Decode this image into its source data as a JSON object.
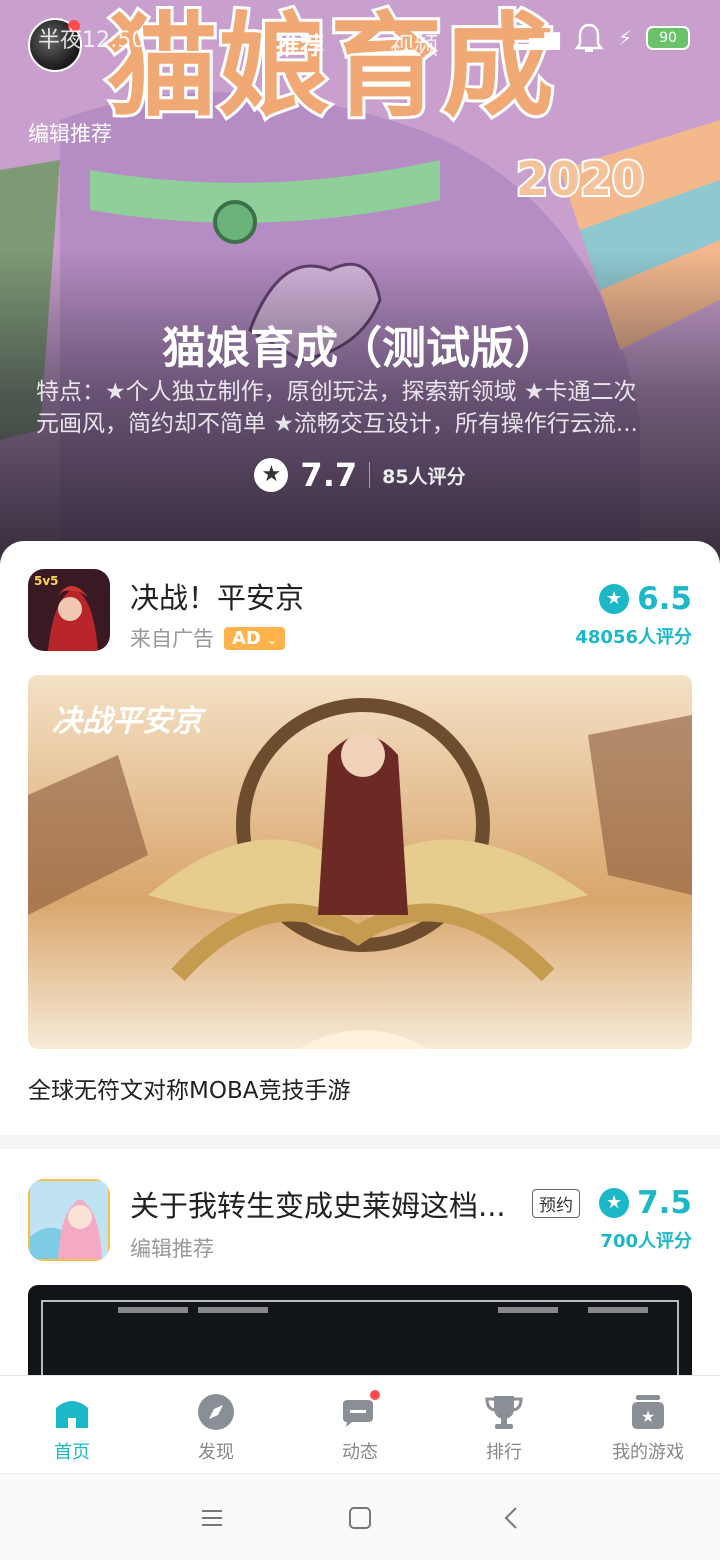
{
  "status_bar": {
    "time": "半夜12:50",
    "battery": "90"
  },
  "top_tabs": [
    {
      "label": "推荐",
      "active": true
    },
    {
      "label": "视频",
      "active": false
    }
  ],
  "hero": {
    "section_label": "编辑推荐",
    "title": "猫娘育成（测试版）",
    "desc_line1": "特点：★个人独立制作，原创玩法，探索新领域 ★卡通二次",
    "desc_line2": "元画风，简约却不简单 ★流畅交互设计，所有操作行云流...",
    "score": "7.7",
    "rating_count": "85人评分",
    "art_text": "猫娘育成",
    "art_year": "2020"
  },
  "games": [
    {
      "name": "决战！平安京",
      "source": "来自广告",
      "badge": "AD",
      "score": "6.5",
      "rating_count": "48056人评分",
      "banner_logo": "决战平安京",
      "tagline": "全球无符文对称MOBA竞技手游"
    },
    {
      "name": "关于我转生变成史莱姆这档...",
      "badge": "预约",
      "source": "编辑推荐",
      "score": "7.5",
      "rating_count": "700人评分"
    }
  ],
  "bottom_nav": [
    {
      "label": "首页",
      "icon": "home-icon",
      "active": true
    },
    {
      "label": "发现",
      "icon": "compass-icon",
      "active": false
    },
    {
      "label": "动态",
      "icon": "chat-icon",
      "active": false,
      "badge": true
    },
    {
      "label": "排行",
      "icon": "trophy-icon",
      "active": false
    },
    {
      "label": "我的游戏",
      "icon": "game-library-icon",
      "active": false
    }
  ],
  "colors": {
    "accent": "#1cb8c8",
    "ad_badge": "#ffb34a",
    "notification": "#ff4b4b"
  }
}
